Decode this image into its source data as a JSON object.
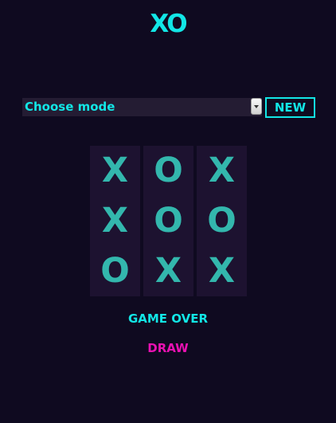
{
  "app": {
    "title": "XO"
  },
  "controls": {
    "mode_select": {
      "selected": "Choose mode"
    },
    "new_button_label": "NEW"
  },
  "board": {
    "columns": [
      [
        "X",
        "X",
        "O"
      ],
      [
        "O",
        "O",
        "X"
      ],
      [
        "X",
        "O",
        "X"
      ]
    ]
  },
  "status": {
    "game_over": "GAME OVER",
    "result": "DRAW"
  },
  "colors": {
    "background": "#0f0a20",
    "accent_cyan": "#12e6e6",
    "mark_teal": "#33b7ad",
    "result_magenta": "#ea11b2",
    "column_bg": "#1d1230"
  }
}
